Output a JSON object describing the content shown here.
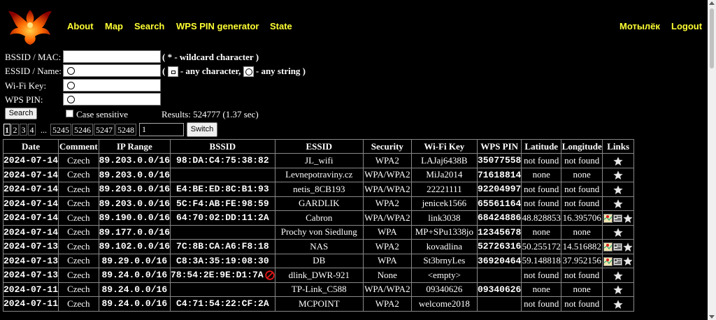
{
  "nav": {
    "items": [
      "About",
      "Map",
      "Search",
      "WPS PIN generator",
      "State"
    ],
    "user": "Мотылёк",
    "logout": "Logout"
  },
  "form": {
    "bssid_label": "BSSID / MAC:",
    "bssid_hint": "( * - wildcard character )",
    "essid_label": "ESSID / Name:",
    "essid_hint_open": "(",
    "essid_hint_any_char": "- any character,",
    "essid_hint_any_string": "- any string )",
    "wifikey_label": "Wi-Fi Key:",
    "wpspin_label": "WPS PIN:",
    "search_button": "Search",
    "case_sensitive_label": "Case sensitive",
    "results_text": "Results: 524777 (1.37 sec)"
  },
  "pager": {
    "pages": [
      "1",
      "2",
      "3",
      "4",
      "...",
      "5245",
      "5246",
      "5247",
      "5248"
    ],
    "goto_value": "1",
    "switch_button": "Switch"
  },
  "table": {
    "headers": [
      "Date",
      "Comment",
      "IP Range",
      "BSSID",
      "ESSID",
      "Security",
      "Wi-Fi Key",
      "WPS PIN",
      "Latitude",
      "Longitude",
      "Links"
    ],
    "rows": [
      {
        "date": "2024-07-14",
        "comment": "Czech",
        "ip": "89.203.0.0/16",
        "bssid": "98:DA:C4:75:38:82",
        "essid": "JL_wifi",
        "security": "WPA2",
        "key": "LAJaj6438B",
        "pin": "35077558",
        "lat": "not found",
        "lon": "not found",
        "map": false,
        "ban": false
      },
      {
        "date": "2024-07-14",
        "comment": "Czech",
        "ip": "89.203.0.0/16",
        "bssid": "",
        "essid": "Levnepotraviny.cz",
        "security": "WPA/WPA2",
        "key": "MiJa2014",
        "pin": "71618814",
        "lat": "none",
        "lon": "none",
        "map": false,
        "ban": false
      },
      {
        "date": "2024-07-14",
        "comment": "Czech",
        "ip": "89.203.0.0/16",
        "bssid": "E4:BE:ED:8C:B1:93",
        "essid": "netis_8CB193",
        "security": "WPA/WPA2",
        "key": "22221111",
        "pin": "92204997",
        "lat": "not found",
        "lon": "not found",
        "map": false,
        "ban": false
      },
      {
        "date": "2024-07-14",
        "comment": "Czech",
        "ip": "89.203.0.0/16",
        "bssid": "5C:F4:AB:FE:98:59",
        "essid": "GARDLIK",
        "security": "WPA2",
        "key": "jenicek1566",
        "pin": "65561164",
        "lat": "not found",
        "lon": "not found",
        "map": false,
        "ban": false
      },
      {
        "date": "2024-07-14",
        "comment": "Czech",
        "ip": "89.190.0.0/16",
        "bssid": "64:70:02:DD:11:2A",
        "essid": "Cabron",
        "security": "WPA/WPA2",
        "key": "link3038",
        "pin": "68424886",
        "lat": "48.828853",
        "lon": "16.395706",
        "map": true,
        "ban": false
      },
      {
        "date": "2024-07-14",
        "comment": "Czech",
        "ip": "89.177.0.0/16",
        "bssid": "",
        "essid": "Prochy von Siedlung",
        "security": "WPA",
        "key": "MP+SPu1338jo",
        "pin": "12345678",
        "lat": "none",
        "lon": "none",
        "map": false,
        "ban": false
      },
      {
        "date": "2024-07-13",
        "comment": "Czech",
        "ip": "89.102.0.0/16",
        "bssid": "7C:8B:CA:A6:F8:18",
        "essid": "NAS",
        "security": "WPA2",
        "key": "kovadlina",
        "pin": "52726316",
        "lat": "50.255172",
        "lon": "14.516882",
        "map": true,
        "ban": false
      },
      {
        "date": "2024-07-13",
        "comment": "Czech",
        "ip": "89.29.0.0/16",
        "bssid": "C8:3A:35:19:08:30",
        "essid": "DB",
        "security": "WPA",
        "key": "St3brnyLes",
        "pin": "36920464",
        "lat": "59.148818",
        "lon": "37.952156",
        "map": true,
        "ban": false
      },
      {
        "date": "2024-07-13",
        "comment": "Czech",
        "ip": "89.24.0.0/16",
        "bssid": "78:54:2E:9E:D1:7A",
        "essid": "dlink_DWR-921",
        "security": "None",
        "key": "<empty>",
        "pin": "",
        "lat": "not found",
        "lon": "not found",
        "map": false,
        "ban": true
      },
      {
        "date": "2024-07-11",
        "comment": "Czech",
        "ip": "89.24.0.0/16",
        "bssid": "",
        "essid": "TP-Link_C588",
        "security": "WPA/WPA2",
        "key": "09340626",
        "pin": "09340626",
        "lat": "none",
        "lon": "none",
        "map": false,
        "ban": false
      },
      {
        "date": "2024-07-11",
        "comment": "Czech",
        "ip": "89.24.0.0/16",
        "bssid": "C4:71:54:22:CF:2A",
        "essid": "MCPOINT",
        "security": "WPA2",
        "key": "welcome2018",
        "pin": "",
        "lat": "not found",
        "lon": "not found",
        "map": false,
        "ban": false
      }
    ]
  },
  "colors": {
    "nav": "#ffff33",
    "background": "#000000",
    "text": "#ffffff"
  },
  "icons": {
    "logo": "phoenix-logo",
    "star": "star-icon",
    "map": "map-icon",
    "ban": "ban-icon"
  }
}
